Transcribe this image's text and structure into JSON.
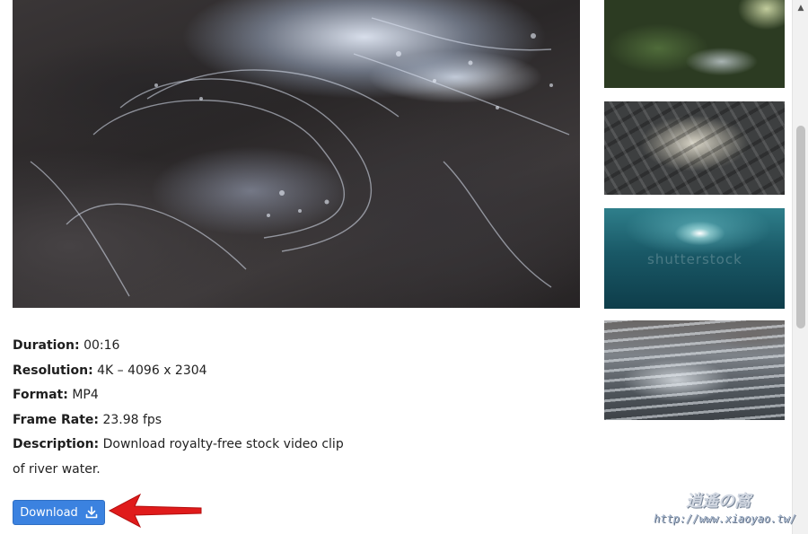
{
  "video": {
    "info": [
      {
        "label": "Duration:",
        "value": "00:16"
      },
      {
        "label": "Resolution:",
        "value": "4K – 4096 x 2304"
      },
      {
        "label": "Format:",
        "value": "MP4"
      },
      {
        "label": "Frame Rate:",
        "value": "23.98 fps"
      }
    ],
    "description_label": "Description:",
    "description_value": "Download royalty-free stock video clip of river water."
  },
  "download": {
    "label": "Download",
    "icon": "download-icon"
  },
  "thumbnails": {
    "watermark": "shutterstock"
  },
  "site_watermark": {
    "logo": "逍遙の窩",
    "url": "http://www.xiaoyao.tw/"
  },
  "colors": {
    "accent": "#3b82e0",
    "arrow": "#e01b1b"
  }
}
